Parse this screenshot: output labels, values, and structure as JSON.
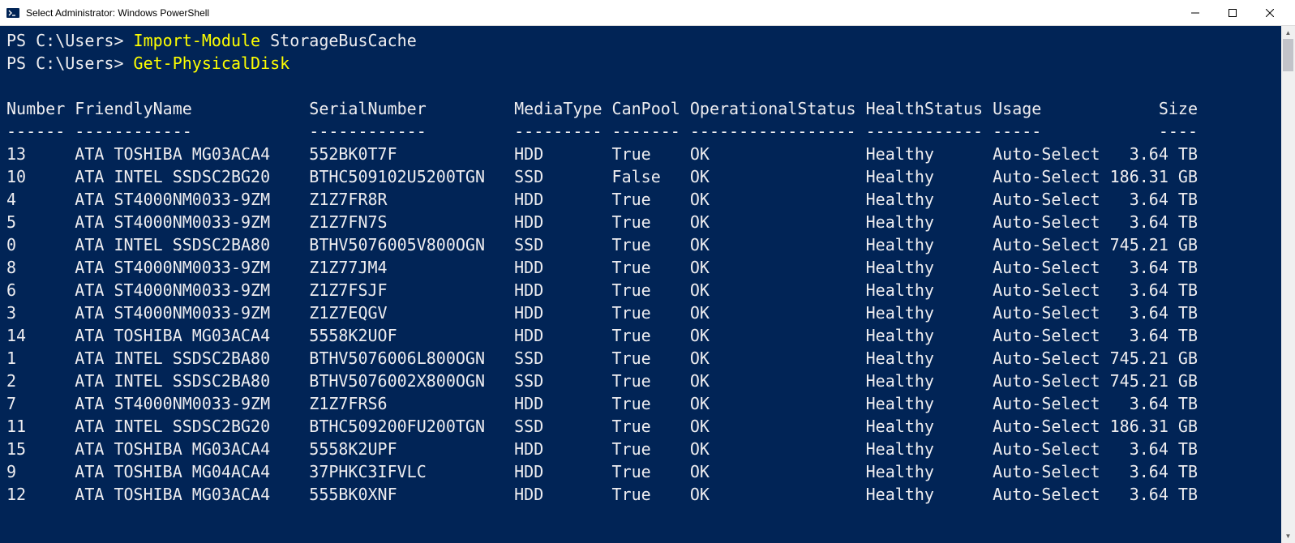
{
  "window": {
    "title": "Select Administrator: Windows PowerShell"
  },
  "terminal": {
    "prompt": "PS C:\\Users>",
    "commands": [
      {
        "cmd": "Import-Module",
        "arg": "StorageBusCache"
      },
      {
        "cmd": "Get-PhysicalDisk",
        "arg": ""
      }
    ],
    "columns": {
      "Number": 6,
      "FriendlyName": 23,
      "SerialNumber": 20,
      "MediaType": 9,
      "CanPool": 7,
      "OperationalStatus": 17,
      "HealthStatus": 12,
      "Usage": 11,
      "Size": 9
    },
    "headerSep": {
      "Number": "------",
      "FriendlyName": "------------",
      "SerialNumber": "------------",
      "MediaType": "---------",
      "CanPool": "-------",
      "OperationalStatus": "-----------------",
      "HealthStatus": "------------",
      "Usage": "-----",
      "Size": "----"
    },
    "rows": [
      {
        "Number": "13",
        "FriendlyName": "ATA TOSHIBA MG03ACA4",
        "SerialNumber": "552BK0T7F",
        "MediaType": "HDD",
        "CanPool": "True",
        "OperationalStatus": "OK",
        "HealthStatus": "Healthy",
        "Usage": "Auto-Select",
        "Size": "3.64 TB"
      },
      {
        "Number": "10",
        "FriendlyName": "ATA INTEL SSDSC2BG20",
        "SerialNumber": "BTHC509102U5200TGN",
        "MediaType": "SSD",
        "CanPool": "False",
        "OperationalStatus": "OK",
        "HealthStatus": "Healthy",
        "Usage": "Auto-Select",
        "Size": "186.31 GB"
      },
      {
        "Number": "4",
        "FriendlyName": "ATA ST4000NM0033-9ZM",
        "SerialNumber": "Z1Z7FR8R",
        "MediaType": "HDD",
        "CanPool": "True",
        "OperationalStatus": "OK",
        "HealthStatus": "Healthy",
        "Usage": "Auto-Select",
        "Size": "3.64 TB"
      },
      {
        "Number": "5",
        "FriendlyName": "ATA ST4000NM0033-9ZM",
        "SerialNumber": "Z1Z7FN7S",
        "MediaType": "HDD",
        "CanPool": "True",
        "OperationalStatus": "OK",
        "HealthStatus": "Healthy",
        "Usage": "Auto-Select",
        "Size": "3.64 TB"
      },
      {
        "Number": "0",
        "FriendlyName": "ATA INTEL SSDSC2BA80",
        "SerialNumber": "BTHV5076005V800OGN",
        "MediaType": "SSD",
        "CanPool": "True",
        "OperationalStatus": "OK",
        "HealthStatus": "Healthy",
        "Usage": "Auto-Select",
        "Size": "745.21 GB"
      },
      {
        "Number": "8",
        "FriendlyName": "ATA ST4000NM0033-9ZM",
        "SerialNumber": "Z1Z77JM4",
        "MediaType": "HDD",
        "CanPool": "True",
        "OperationalStatus": "OK",
        "HealthStatus": "Healthy",
        "Usage": "Auto-Select",
        "Size": "3.64 TB"
      },
      {
        "Number": "6",
        "FriendlyName": "ATA ST4000NM0033-9ZM",
        "SerialNumber": "Z1Z7FSJF",
        "MediaType": "HDD",
        "CanPool": "True",
        "OperationalStatus": "OK",
        "HealthStatus": "Healthy",
        "Usage": "Auto-Select",
        "Size": "3.64 TB"
      },
      {
        "Number": "3",
        "FriendlyName": "ATA ST4000NM0033-9ZM",
        "SerialNumber": "Z1Z7EQGV",
        "MediaType": "HDD",
        "CanPool": "True",
        "OperationalStatus": "OK",
        "HealthStatus": "Healthy",
        "Usage": "Auto-Select",
        "Size": "3.64 TB"
      },
      {
        "Number": "14",
        "FriendlyName": "ATA TOSHIBA MG03ACA4",
        "SerialNumber": "5558K2UOF",
        "MediaType": "HDD",
        "CanPool": "True",
        "OperationalStatus": "OK",
        "HealthStatus": "Healthy",
        "Usage": "Auto-Select",
        "Size": "3.64 TB"
      },
      {
        "Number": "1",
        "FriendlyName": "ATA INTEL SSDSC2BA80",
        "SerialNumber": "BTHV5076006L800OGN",
        "MediaType": "SSD",
        "CanPool": "True",
        "OperationalStatus": "OK",
        "HealthStatus": "Healthy",
        "Usage": "Auto-Select",
        "Size": "745.21 GB"
      },
      {
        "Number": "2",
        "FriendlyName": "ATA INTEL SSDSC2BA80",
        "SerialNumber": "BTHV5076002X800OGN",
        "MediaType": "SSD",
        "CanPool": "True",
        "OperationalStatus": "OK",
        "HealthStatus": "Healthy",
        "Usage": "Auto-Select",
        "Size": "745.21 GB"
      },
      {
        "Number": "7",
        "FriendlyName": "ATA ST4000NM0033-9ZM",
        "SerialNumber": "Z1Z7FRS6",
        "MediaType": "HDD",
        "CanPool": "True",
        "OperationalStatus": "OK",
        "HealthStatus": "Healthy",
        "Usage": "Auto-Select",
        "Size": "3.64 TB"
      },
      {
        "Number": "11",
        "FriendlyName": "ATA INTEL SSDSC2BG20",
        "SerialNumber": "BTHC509200FU200TGN",
        "MediaType": "SSD",
        "CanPool": "True",
        "OperationalStatus": "OK",
        "HealthStatus": "Healthy",
        "Usage": "Auto-Select",
        "Size": "186.31 GB"
      },
      {
        "Number": "15",
        "FriendlyName": "ATA TOSHIBA MG03ACA4",
        "SerialNumber": "5558K2UPF",
        "MediaType": "HDD",
        "CanPool": "True",
        "OperationalStatus": "OK",
        "HealthStatus": "Healthy",
        "Usage": "Auto-Select",
        "Size": "3.64 TB"
      },
      {
        "Number": "9",
        "FriendlyName": "ATA TOSHIBA MG04ACA4",
        "SerialNumber": "37PHKC3IFVLC",
        "MediaType": "HDD",
        "CanPool": "True",
        "OperationalStatus": "OK",
        "HealthStatus": "Healthy",
        "Usage": "Auto-Select",
        "Size": "3.64 TB"
      },
      {
        "Number": "12",
        "FriendlyName": "ATA TOSHIBA MG03ACA4",
        "SerialNumber": "555BK0XNF",
        "MediaType": "HDD",
        "CanPool": "True",
        "OperationalStatus": "OK",
        "HealthStatus": "Healthy",
        "Usage": "Auto-Select",
        "Size": "3.64 TB"
      }
    ]
  }
}
